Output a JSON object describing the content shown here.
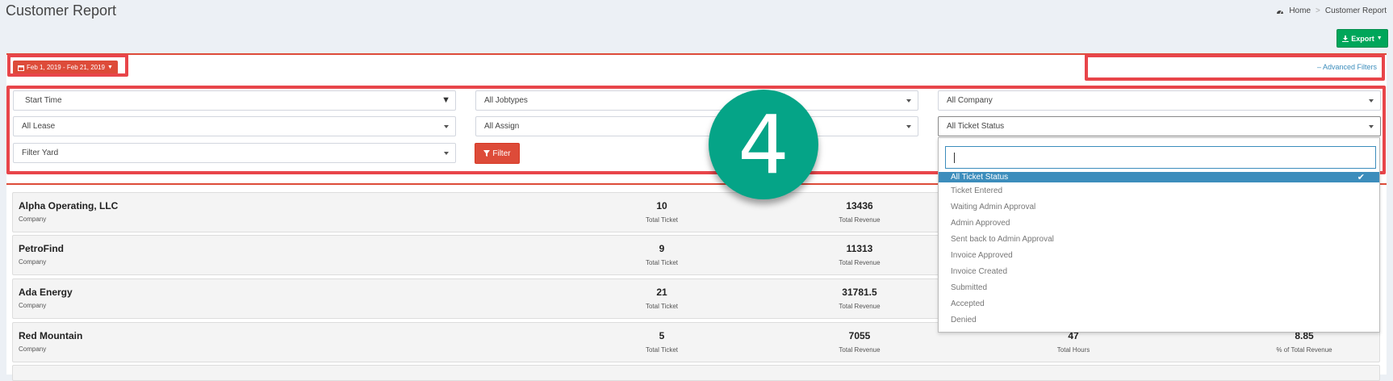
{
  "header": {
    "title": "Customer Report"
  },
  "breadcrumb": {
    "home": "Home",
    "current": "Customer Report",
    "separator": ">"
  },
  "toolbar": {
    "export_label": "Export"
  },
  "date_range": {
    "label": "Feb 1, 2019 - Feb 21, 2019"
  },
  "advanced_filters": {
    "label": "Advanced Filters"
  },
  "filters": {
    "start_time": "Start Time",
    "jobtypes": "All Jobtypes",
    "company": "All Company",
    "lease": "All Lease",
    "assign": "All Assign",
    "ticket_status": "All Ticket Status",
    "yard": "Filter Yard",
    "filter_button": "Filter"
  },
  "step_badge": "4",
  "dropdown": {
    "search_value": "",
    "options": [
      {
        "label": "All Ticket Status",
        "selected": true
      },
      {
        "label": "Ticket Entered"
      },
      {
        "label": "Waiting Admin Approval"
      },
      {
        "label": "Admin Approved"
      },
      {
        "label": "Sent back to Admin Approval"
      },
      {
        "label": "Invoice Approved"
      },
      {
        "label": "Invoice Created"
      },
      {
        "label": "Submitted"
      },
      {
        "label": "Accepted"
      },
      {
        "label": "Denied"
      }
    ]
  },
  "companies": [
    {
      "name": "Alpha Operating, LLC",
      "sub": "Company",
      "total_ticket": "10",
      "total_ticket_label": "Total Ticket",
      "total_revenue": "13436",
      "total_revenue_label": "Total Revenue"
    },
    {
      "name": "PetroFind",
      "sub": "Company",
      "total_ticket": "9",
      "total_ticket_label": "Total Ticket",
      "total_revenue": "11313",
      "total_revenue_label": "Total Revenue"
    },
    {
      "name": "Ada Energy",
      "sub": "Company",
      "total_ticket": "21",
      "total_ticket_label": "Total Ticket",
      "total_revenue": "31781.5",
      "total_revenue_label": "Total Revenue"
    },
    {
      "name": "Red Mountain",
      "sub": "Company",
      "total_ticket": "5",
      "total_ticket_label": "Total Ticket",
      "total_revenue": "7055",
      "total_revenue_label": "Total Revenue",
      "total_hours": "47",
      "total_hours_label": "Total Hours",
      "pct_revenue": "8.85",
      "pct_revenue_label": "% of Total Revenue"
    }
  ],
  "colors": {
    "accent_red": "#dd4b39",
    "export_green": "#00a65a",
    "badge_teal": "#05a487",
    "highlight": "#e8454a",
    "selected_blue": "#3c8dbc"
  }
}
